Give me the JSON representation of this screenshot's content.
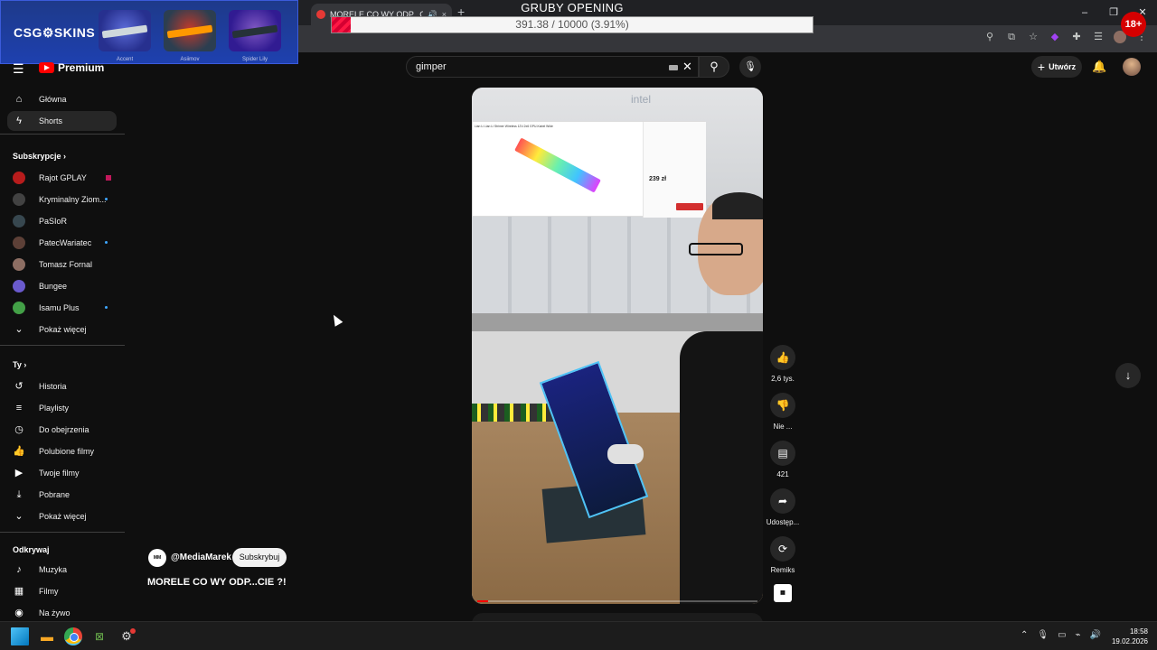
{
  "browser": {
    "tab_title": "MORELE CO WY ODP...CIE ?!",
    "tab_mute_icon": "speaker-icon",
    "tab_close": "×",
    "new_tab": "+",
    "tab_scroll": "‹",
    "window_controls": {
      "minimize": "–",
      "maximize": "❐",
      "close": "✕"
    },
    "toolbar_icons": [
      "zoom-icon",
      "install-icon",
      "bookmark-star-icon",
      "extension-icon",
      "puzzle-icon",
      "reading-list-icon",
      "profile-icon",
      "menu-icon"
    ]
  },
  "overlay": {
    "title": "GRUBY OPENING",
    "progress_text": "391.38 / 10000 (3.91%)",
    "progress_fraction": 0.0391,
    "age_badge": "18+",
    "csg_logo": "CSG⚙SKINS",
    "skins": [
      {
        "name": "Accent"
      },
      {
        "name": "Asiimov"
      },
      {
        "name": "Spider Lily"
      }
    ]
  },
  "youtube": {
    "logo": "Premium",
    "search_value": "gimper",
    "create_label": "Utwórz",
    "sidebar": {
      "main": [
        {
          "label": "Główna",
          "icon": "home-icon"
        },
        {
          "label": "Shorts",
          "icon": "shorts-icon",
          "active": true
        }
      ],
      "subs_header": "Subskrypcje",
      "subscriptions": [
        {
          "label": "Rajot GPLAY",
          "live": true
        },
        {
          "label": "Kryminalny Ziom...",
          "dot": true
        },
        {
          "label": "PaSIoR"
        },
        {
          "label": "PatecWariatec",
          "dot": true
        },
        {
          "label": "Tomasz Fornal"
        },
        {
          "label": "Bungee"
        },
        {
          "label": "Isamu Plus",
          "dot": true
        },
        {
          "label": "Pokaż więcej"
        }
      ],
      "you_header": "Ty",
      "you": [
        {
          "label": "Historia",
          "icon": "history-icon"
        },
        {
          "label": "Playlisty",
          "icon": "playlist-icon"
        },
        {
          "label": "Do obejrzenia",
          "icon": "watch-later-icon"
        },
        {
          "label": "Polubione filmy",
          "icon": "like-icon"
        },
        {
          "label": "Twoje filmy",
          "icon": "your-videos-icon"
        },
        {
          "label": "Pobrane",
          "icon": "download-icon"
        },
        {
          "label": "Pokaż więcej",
          "icon": "chevron-down-icon"
        }
      ],
      "explore_header": "Odkrywaj",
      "explore": [
        {
          "label": "Muzyka",
          "icon": "music-icon"
        },
        {
          "label": "Filmy",
          "icon": "movies-icon"
        },
        {
          "label": "Na żywo",
          "icon": "live-icon"
        }
      ]
    },
    "short": {
      "channel": "@MediaMarek",
      "subscribe": "Subskrybuj",
      "title": "MORELE CO WY ODP...CIE ?!",
      "overlay_product": "Lian Li Lian Li Strimer Wireless 12V-2x6 GPU-Kabel Wide",
      "overlay_price": "239 zł",
      "watermark": "intel"
    },
    "actions": {
      "likes": "2,6 tys.",
      "dislike": "Nie ...",
      "comments": "421",
      "share": "Udostęp...",
      "remix": "Remiks"
    }
  },
  "taskbar": {
    "time": "18:58",
    "date": "19.02.2026"
  }
}
